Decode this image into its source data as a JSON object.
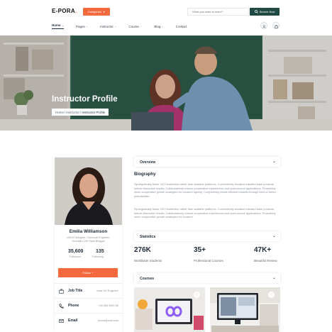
{
  "header": {
    "logo_text": "E-PORA",
    "logo_dot": ".",
    "category_button": "Categories",
    "search_placeholder": "What you want to learn?",
    "search_button": "Search Now",
    "nav": [
      {
        "label": "Home"
      },
      {
        "label": "Pages"
      },
      {
        "label": "Instructor"
      },
      {
        "label": "Course"
      },
      {
        "label": "Blog"
      },
      {
        "label": "Contact"
      }
    ]
  },
  "hero": {
    "title": "Instructor Profile",
    "breadcrumb": {
      "home": "Home",
      "sep": " / ",
      "parent": "Instructor",
      "current": "Instructor Profile"
    }
  },
  "profile": {
    "name": "Emilia Williamson",
    "role": "UX/UI Designer, Chemical Engineer, Youtuber, Life Style Blogger",
    "followers_count": "35,600",
    "followers_label": "Followers",
    "following_count": "135",
    "following_label": "Following",
    "follow_button": "Follow +",
    "info": [
      {
        "key": "Job Title",
        "value": "Lead UX Engineer",
        "icon": "briefcase-icon"
      },
      {
        "key": "Phone",
        "value": "+00 365 9852 65",
        "icon": "phone-icon"
      },
      {
        "key": "Email",
        "value": "epora@mail.com",
        "icon": "mail-icon"
      }
    ]
  },
  "overview": {
    "section_title": "Overview",
    "bio_title": "Biography",
    "para1": "Synergistically foster 24/7 leadership rather than scalable platforms. Conveniently visualize installed base products before interactive results. Collaboratively restore cooperative experiences and open-source applications. Proactively mesh cooperative growth strategies for covalent ogenity. Competently create efficient markets through best-of-breed potentialities.",
    "para2": "Synergistically foster 24/7 leadership rather than scalable platforms. Conveniently visualize installed base products before interactive results. Collaboratively restore cooperative experiences and open-source applications. Proactively mesh cooperative growth strategies for covalent."
  },
  "statistics": {
    "section_title": "Statistics",
    "items": [
      {
        "value": "276K",
        "label": "Worldwide Students"
      },
      {
        "value": "35+",
        "label": "Professional Courses"
      },
      {
        "value": "47K+",
        "label": "Beautiful Review"
      }
    ]
  },
  "courses": {
    "section_title": "Courses"
  },
  "colors": {
    "accent": "#f4683d",
    "dark_green": "#1f4a44",
    "text_dark": "#1d2b3a"
  }
}
